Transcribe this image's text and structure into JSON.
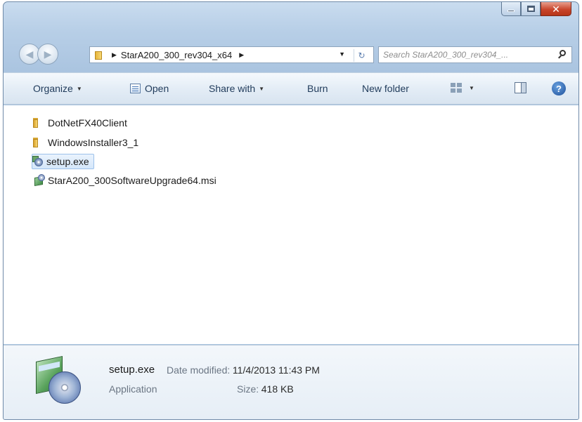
{
  "window": {
    "caption_buttons": {
      "minimize_icon": "minimize-icon",
      "maximize_icon": "maximize-icon",
      "close_glyph": "✕"
    }
  },
  "address_bar": {
    "crumb": "StarA200_300_rev304_x64"
  },
  "search": {
    "placeholder": "Search StarA200_300_rev304_..."
  },
  "toolbar": {
    "organize_label": "Organize",
    "open_label": "Open",
    "share_label": "Share with",
    "burn_label": "Burn",
    "new_folder_label": "New folder"
  },
  "files": [
    {
      "name": "DotNetFX40Client",
      "type": "folder"
    },
    {
      "name": "WindowsInstaller3_1",
      "type": "folder"
    },
    {
      "name": "setup.exe",
      "type": "exe",
      "selected": true
    },
    {
      "name": "StarA200_300SoftwareUpgrade64.msi",
      "type": "msi"
    }
  ],
  "details": {
    "name": "setup.exe",
    "modified_label": "Date modified:",
    "modified_value": "11/4/2013 11:43 PM",
    "type": "Application",
    "size_label": "Size:",
    "size_value": "418 KB"
  },
  "colors": {
    "title_bar": "#b8cfe7",
    "toolbar": "#e4edf6",
    "selection": "#d5e7fa",
    "close_button": "#c9462c"
  }
}
